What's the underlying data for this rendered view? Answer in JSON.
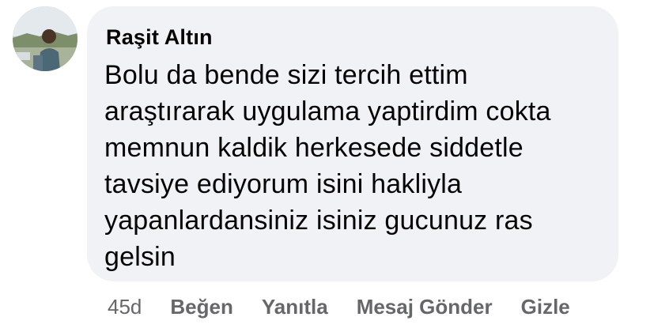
{
  "comment": {
    "author": "Raşit Altın",
    "text": "Bolu da bende sizi tercih ettim\naraştırarak uygulama yaptirdim cokta\nmemnun kaldik herkesede siddetle\ntavsiye ediyorum isini hakliyla\nyapanlardansiniz isiniz gucunuz ras\ngelsin",
    "avatar_icon": "profile-photo"
  },
  "actions": {
    "timestamp": "45d",
    "like_label": "Beğen",
    "reply_label": "Yanıtla",
    "message_label": "Mesaj Gönder",
    "hide_label": "Gizle"
  },
  "colors": {
    "bubble_bg": "#f0f2f5",
    "text": "#050505",
    "secondary_text": "#65676b"
  }
}
